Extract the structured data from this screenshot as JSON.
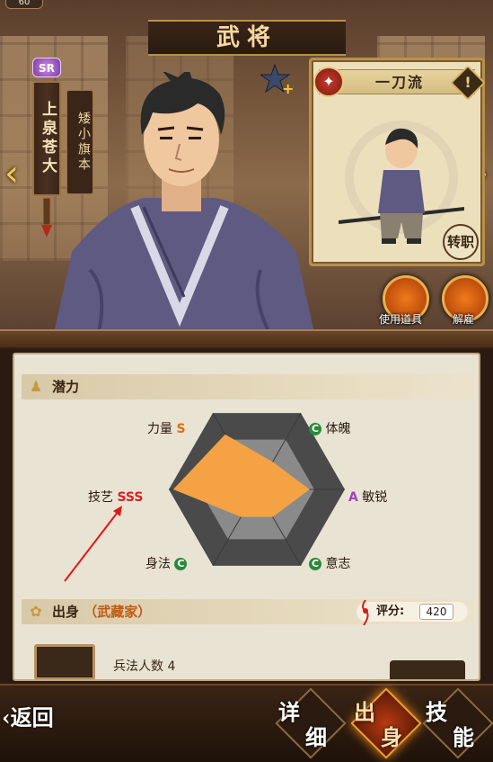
{
  "header": {
    "level": "60",
    "title": "武将"
  },
  "general": {
    "rarity": "SR",
    "name": "上泉苍大",
    "rank": "矮小旗本"
  },
  "skill_card": {
    "name": "一刀流",
    "warning": "!",
    "transfer_seal": "转职"
  },
  "actions": {
    "use_item": "使用道具",
    "dismiss": "解雇"
  },
  "potential": {
    "title": "潜力",
    "stats": [
      {
        "label": "力量",
        "grade": "S"
      },
      {
        "label": "体魄",
        "grade": "C"
      },
      {
        "label": "敏锐",
        "grade": "A"
      },
      {
        "label": "意志",
        "grade": "C"
      },
      {
        "label": "身法",
        "grade": "C"
      },
      {
        "label": "技艺",
        "grade": "SSS"
      }
    ]
  },
  "origin": {
    "title": "出身",
    "family": "（武藏家）",
    "score_label": "评分:",
    "score_value": "420",
    "item_text": "兵法人数 4"
  },
  "footer": {
    "back": "返回",
    "tabs": [
      {
        "top": "详",
        "bottom": "细",
        "active": false
      },
      {
        "top": "出",
        "bottom": "身",
        "active": true
      },
      {
        "top": "技",
        "bottom": "能",
        "active": false
      }
    ]
  },
  "colors": {
    "grade_S": "#e86a10",
    "grade_SSS": "#d8202a",
    "grade_A": "#a040c0",
    "grade_C": "#2a8a3a",
    "radar_fill": "#f4a244",
    "hex_dark": "#4a4a4a",
    "hex_light": "#8a8a8a"
  }
}
